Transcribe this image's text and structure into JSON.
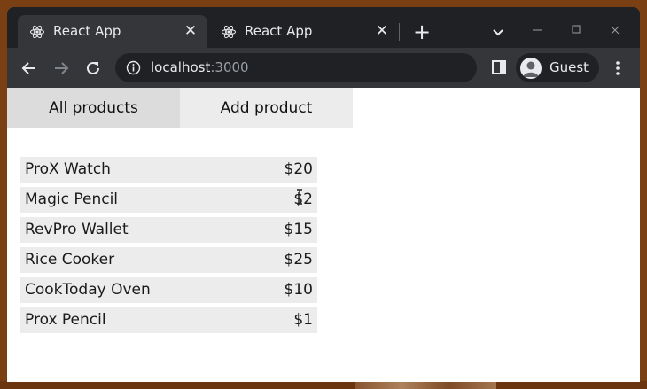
{
  "browser": {
    "tabs": [
      {
        "title": "React App",
        "active": true
      },
      {
        "title": "React App",
        "active": false
      }
    ],
    "url_host": "localhost",
    "url_port": ":3000",
    "profile_name": "Guest",
    "colors": {
      "frame": "#202124",
      "toolbar": "#35363a",
      "text": "#e8eaed"
    }
  },
  "app": {
    "nav": {
      "all_products": "All products",
      "add_product": "Add product"
    },
    "products": [
      {
        "name": "ProX Watch",
        "price": "$20"
      },
      {
        "name": "Magic Pencil",
        "price": "$2"
      },
      {
        "name": "RevPro Wallet",
        "price": "$15"
      },
      {
        "name": "Rice Cooker",
        "price": "$25"
      },
      {
        "name": "CookToday Oven",
        "price": "$10"
      },
      {
        "name": "Prox Pencil",
        "price": "$1"
      }
    ],
    "colors": {
      "active_tab": "#dcdcdc",
      "inactive_tab": "#ececec",
      "row": "#ececec"
    }
  }
}
